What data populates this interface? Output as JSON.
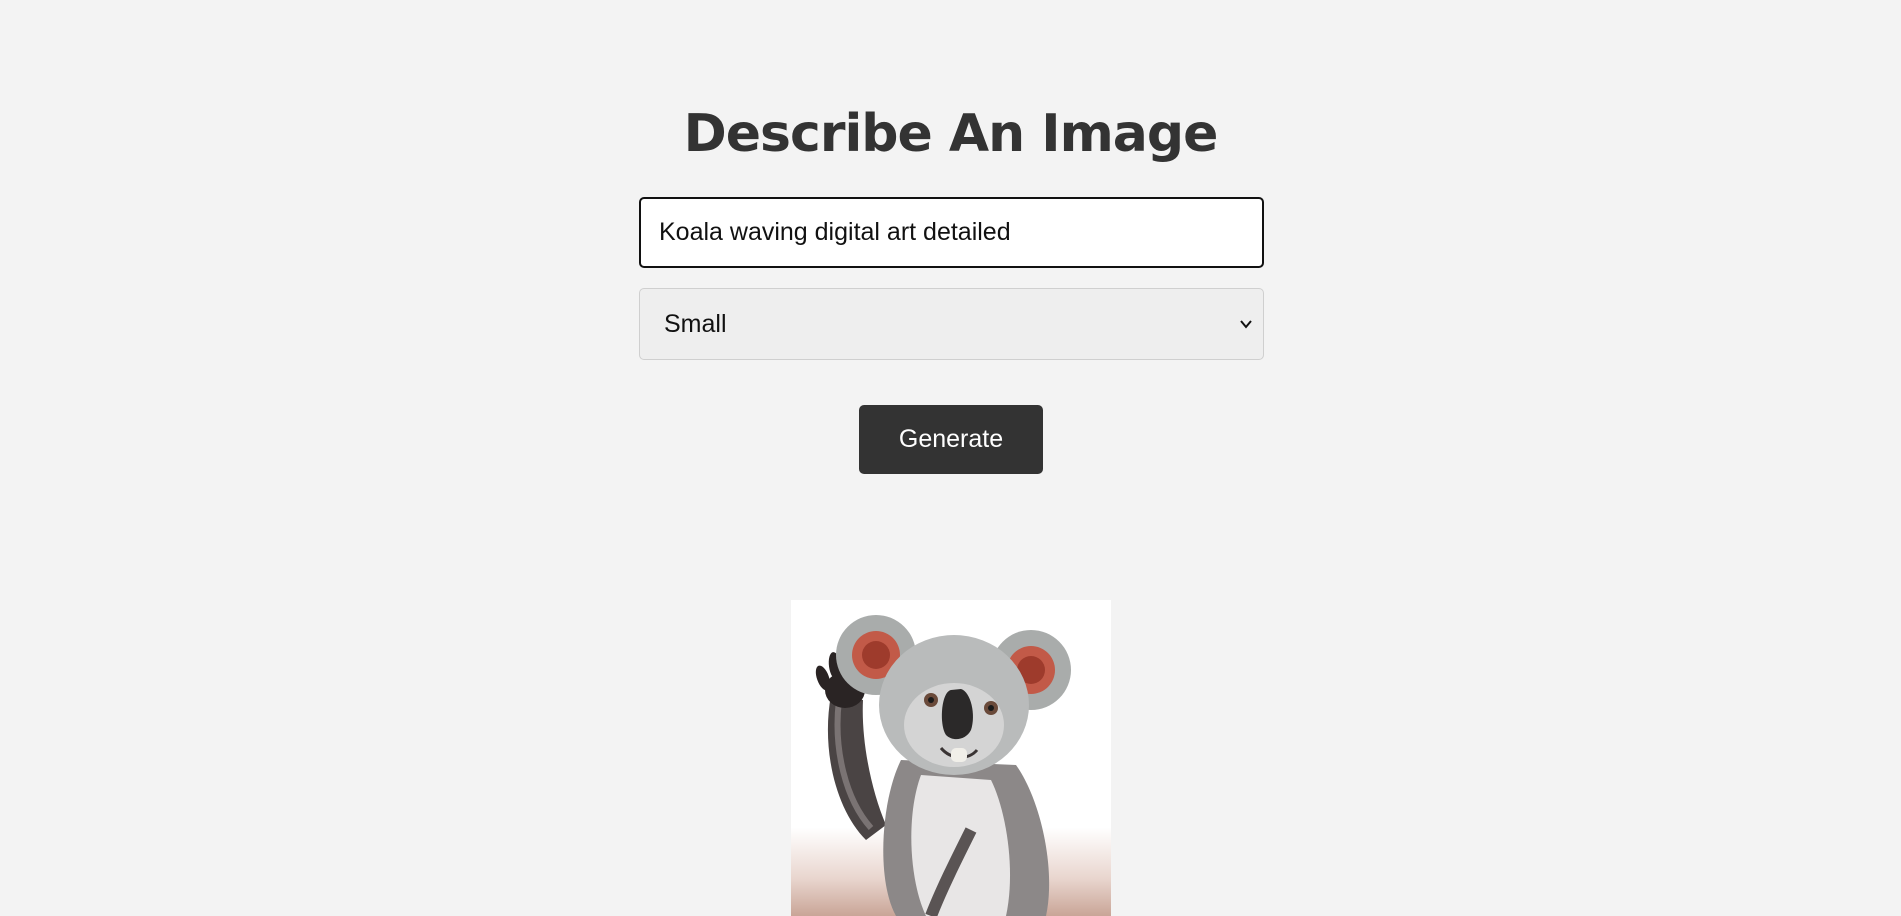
{
  "page": {
    "title": "Describe An Image"
  },
  "form": {
    "prompt_value": "Koala waving digital art detailed",
    "size_selected": "Small",
    "generate_label": "Generate"
  },
  "result": {
    "image_subject": "koala-waving-illustration"
  },
  "colors": {
    "background": "#f3f3f3",
    "title": "#333333",
    "button": "#333333",
    "button_text": "#ffffff"
  }
}
